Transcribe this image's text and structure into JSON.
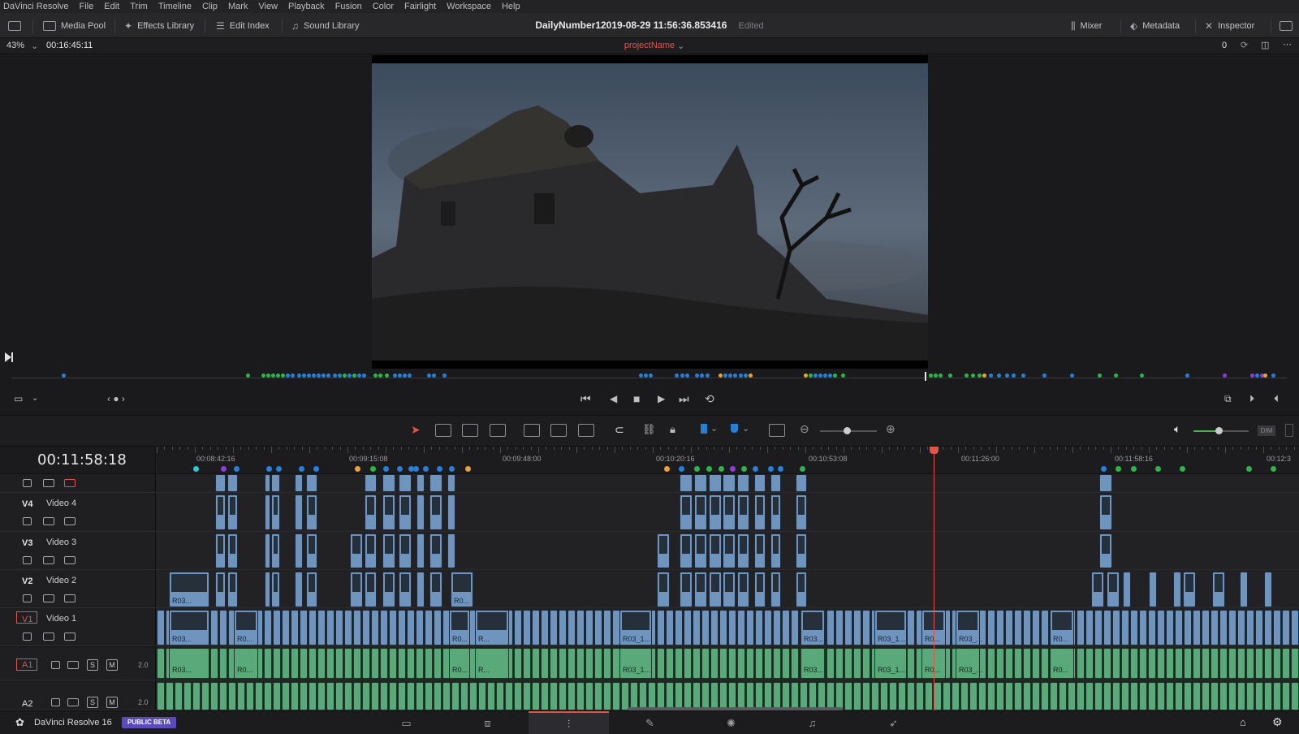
{
  "menu": [
    "DaVinci Resolve",
    "File",
    "Edit",
    "Trim",
    "Timeline",
    "Clip",
    "Mark",
    "View",
    "Playback",
    "Fusion",
    "Color",
    "Fairlight",
    "Workspace",
    "Help"
  ],
  "toolbar": {
    "media_pool": "Media Pool",
    "effects_library": "Effects Library",
    "edit_index": "Edit Index",
    "sound_library": "Sound Library",
    "title": "DailyNumber12019-08-29 11:56:36.853416",
    "status": "Edited",
    "mixer": "Mixer",
    "metadata": "Metadata",
    "inspector": "Inspector"
  },
  "viewer": {
    "zoom": "43%",
    "timecode": "00:16:45:11",
    "project_name": "projectName",
    "counter": "0"
  },
  "timeline": {
    "timecode": "00:11:58:18",
    "ruler": [
      "00:08:42:16",
      "00:09:15:08",
      "00:09:48:00",
      "00:10:20:16",
      "00:10:53:08",
      "00:11:26:00",
      "00:11:58:16",
      "00:12:3"
    ],
    "tracks": [
      {
        "id": "V4",
        "name": "Video 4"
      },
      {
        "id": "V3",
        "name": "Video 3"
      },
      {
        "id": "V2",
        "name": "Video 2"
      },
      {
        "id": "V1",
        "name": "Video 1"
      },
      {
        "id": "A1",
        "level": "2.0"
      },
      {
        "id": "A2",
        "level": "2.0"
      }
    ],
    "v2_labels": [
      "R03...",
      "R0..."
    ],
    "v1_labels": [
      "R03...",
      "R0...",
      "R0...",
      "R...",
      "R03_1...",
      "R03...",
      "R03_1...",
      "R0...",
      "R03_...",
      "R0..."
    ],
    "a1_labels": [
      "R03...",
      "R0...",
      "R0...",
      "R...",
      "R03_1...",
      "R03...",
      "R03_1...",
      "R0...",
      "R03_...",
      "R0..."
    ],
    "solo": "S",
    "mute": "M"
  },
  "bottom": {
    "app_name": "DaVinci Resolve 16",
    "badge": "PUBLIC BETA"
  },
  "colors": {
    "accent_red": "#e2534a",
    "video_clip": "#6f95bf",
    "audio_clip": "#5aa97a",
    "marker_blue": "#2a7fd4",
    "marker_green": "#2fb34a",
    "marker_purple": "#8a3fd9",
    "marker_orange": "#e8a23a",
    "marker_cyan": "#2fc8cf"
  }
}
